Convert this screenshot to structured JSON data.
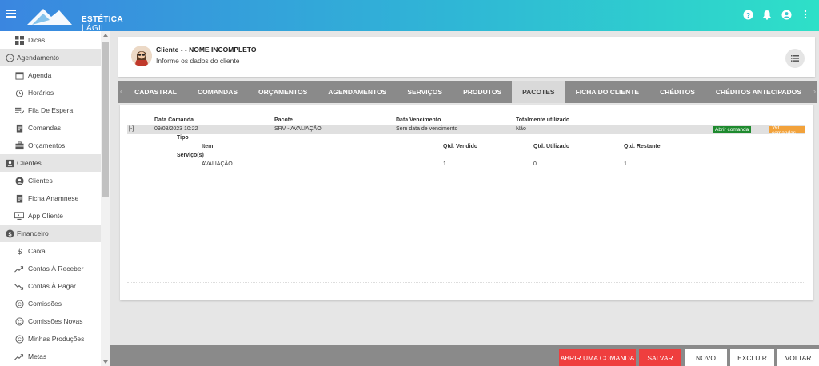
{
  "app": {
    "logo_text_main": "ESTÉTICA",
    "logo_text_sub": "ÁGIL"
  },
  "topbar": {
    "icons": [
      "help-icon",
      "bell-icon",
      "account-icon",
      "more-vert-icon"
    ]
  },
  "sidebar": {
    "entries": [
      {
        "kind": "item",
        "label": "Dicas",
        "icon": "grid-icon"
      },
      {
        "kind": "section",
        "label": "Agendamento",
        "icon": "clock-icon"
      },
      {
        "kind": "item",
        "label": "Agenda",
        "icon": "calendar-icon"
      },
      {
        "kind": "item",
        "label": "Horários",
        "icon": "alarm-icon"
      },
      {
        "kind": "item",
        "label": "Fila De Espera",
        "icon": "queue-icon"
      },
      {
        "kind": "item",
        "label": "Comandas",
        "icon": "clipboard-icon"
      },
      {
        "kind": "item",
        "label": "Orçamentos",
        "icon": "briefcase-icon"
      },
      {
        "kind": "section",
        "label": "Clientes",
        "icon": "contact-icon"
      },
      {
        "kind": "item",
        "label": "Clientes",
        "icon": "user-circle-icon"
      },
      {
        "kind": "item",
        "label": "Ficha Anamnese",
        "icon": "clipboard-icon"
      },
      {
        "kind": "item",
        "label": "App Cliente",
        "icon": "app-icon"
      },
      {
        "kind": "section",
        "label": "Financeiro",
        "icon": "dollar-circle-icon"
      },
      {
        "kind": "item",
        "label": "Caixa",
        "icon": "dollar-icon"
      },
      {
        "kind": "item",
        "label": "Contas À Receber",
        "icon": "trend-up-icon"
      },
      {
        "kind": "item",
        "label": "Contas À Pagar",
        "icon": "trend-down-icon"
      },
      {
        "kind": "item",
        "label": "Comissões",
        "icon": "copyright-icon"
      },
      {
        "kind": "item",
        "label": "Comissões Novas",
        "icon": "copyright-icon"
      },
      {
        "kind": "item",
        "label": "Minhas Produções",
        "icon": "copyright-icon"
      },
      {
        "kind": "item",
        "label": "Metas",
        "icon": "trend-up-icon"
      }
    ]
  },
  "client": {
    "name": "Cliente - - NOME INCOMPLETO",
    "subtitle": "Informe os dados do cliente"
  },
  "tabs": [
    {
      "label": "CADASTRAL",
      "active": false
    },
    {
      "label": "COMANDAS",
      "active": false
    },
    {
      "label": "ORÇAMENTOS",
      "active": false
    },
    {
      "label": "AGENDAMENTOS",
      "active": false
    },
    {
      "label": "SERVIÇOS",
      "active": false
    },
    {
      "label": "PRODUTOS",
      "active": false
    },
    {
      "label": "PACOTES",
      "active": true
    },
    {
      "label": "FICHA DO CLIENTE",
      "active": false
    },
    {
      "label": "CRÉDITOS",
      "active": false
    },
    {
      "label": "CRÉDITOS ANTECIPADOS",
      "active": false
    }
  ],
  "packages": {
    "headers": {
      "date": "Data Comanda",
      "package": "Pacote",
      "due": "Data Vencimento",
      "used": "Totalmente utilizado"
    },
    "row": {
      "toggle": "[-]",
      "date": "09/08/2023 10:22",
      "package": "SRV - AVALIAÇÃO",
      "due": "Sem data de vencimento",
      "used": "Não",
      "open_button": "Abrir comanda",
      "view_button": "Ver comandas"
    },
    "detail": {
      "type_label": "Tipo",
      "item_label": "Item",
      "sold_label": "Qtd. Vendido",
      "usedqty_label": "Qtd. Utilizado",
      "remaining_label": "Qtd. Restante",
      "group_label": "Serviço(s)",
      "item": "AVALIAÇÃO",
      "sold": "1",
      "usedqty": "0",
      "remaining": "1"
    }
  },
  "footer": {
    "open_order": "ABRIR UMA COMANDA",
    "save": "SALVAR",
    "new": "NOVO",
    "delete": "EXCLUIR",
    "back": "VOLTAR"
  },
  "colors": {
    "accent_red": "#ef3e3e",
    "green": "#1e8a2e",
    "orange": "#f2a23b"
  }
}
